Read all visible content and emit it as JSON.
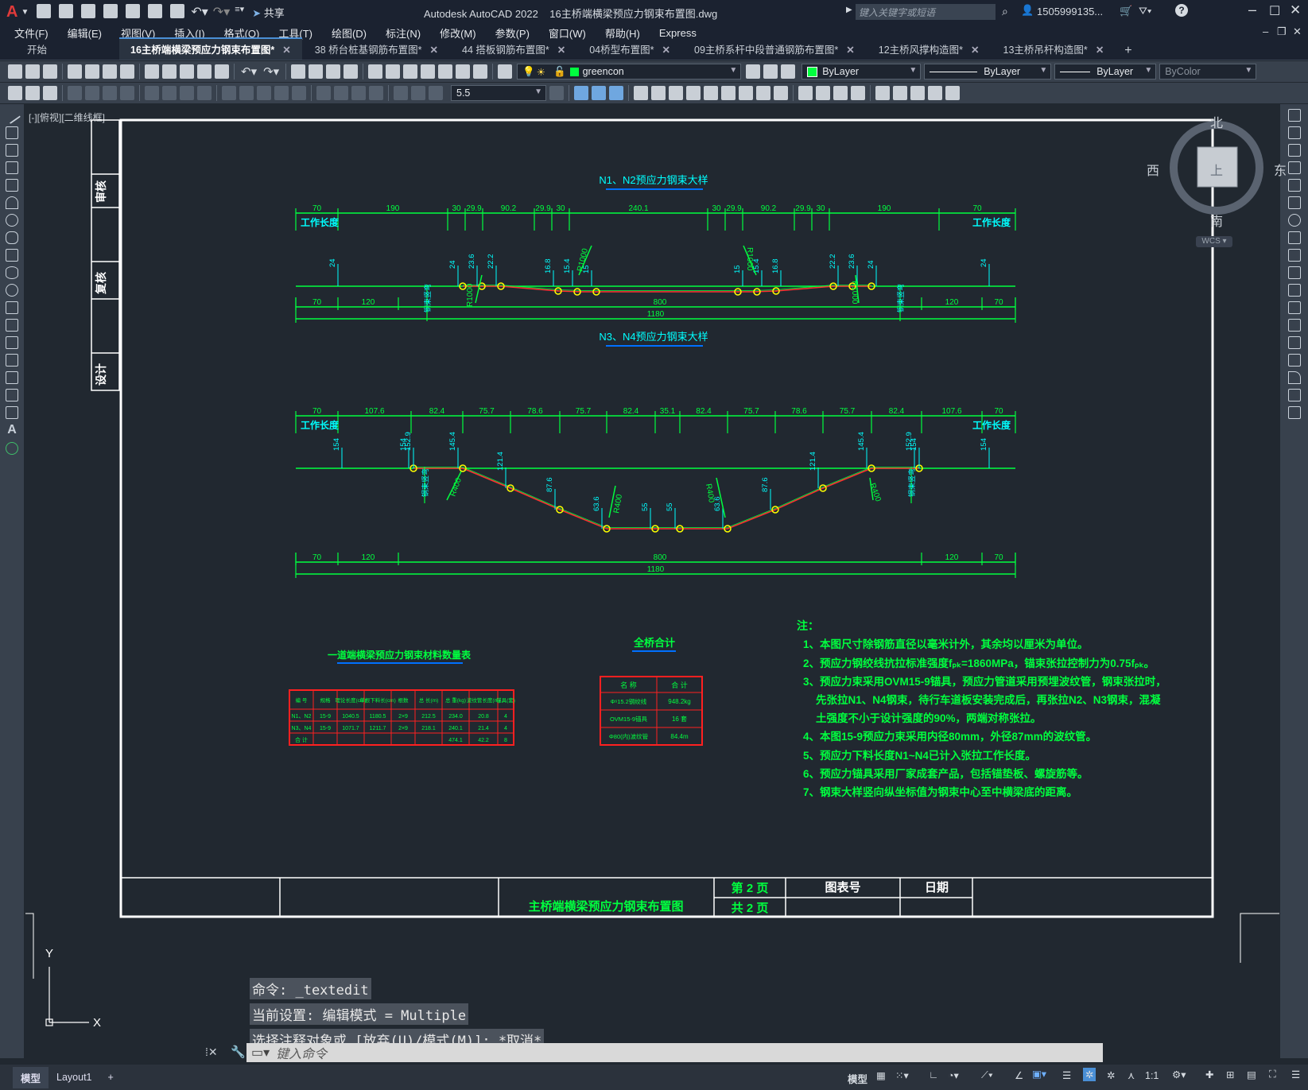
{
  "app": {
    "logo": "A",
    "share_label": "共享",
    "title": "Autodesk AutoCAD 2022",
    "document": "16主桥端横梁预应力钢束布置图.dwg",
    "search_placeholder": "键入关键字或短语",
    "user": "1505999135...",
    "help": "?"
  },
  "menu": [
    "文件(F)",
    "编辑(E)",
    "视图(V)",
    "插入(I)",
    "格式(O)",
    "工具(T)",
    "绘图(D)",
    "标注(N)",
    "修改(M)",
    "参数(P)",
    "窗口(W)",
    "帮助(H)",
    "Express"
  ],
  "tabs": [
    {
      "label": "开始",
      "closable": false
    },
    {
      "label": "16主桥端横梁预应力钢束布置图*",
      "closable": true,
      "active": true
    },
    {
      "label": "38 桥台桩基钢筋布置图*",
      "closable": true
    },
    {
      "label": "44 搭板钢筋布置图*",
      "closable": true
    },
    {
      "label": "04桥型布置图*",
      "closable": true
    },
    {
      "label": "09主桥系杆中段普通钢筋布置图*",
      "closable": true
    },
    {
      "label": "12主桥风撑构造图*",
      "closable": true
    },
    {
      "label": "13主桥吊杆构造图*",
      "closable": true
    }
  ],
  "new_tab": "+",
  "layers": {
    "current_layer": "greencon",
    "color": "ByLayer",
    "linetype": "ByLayer",
    "lineweight": "ByLayer",
    "plotstyle": "ByColor",
    "text_height": "5.5"
  },
  "viewport_label": "[-][俯视][二维线框]",
  "viewcube": {
    "north": "北",
    "south": "南",
    "east": "东",
    "west": "西",
    "top": "上",
    "wcs": "WCS"
  },
  "ucs": {
    "y": "Y",
    "x": "X"
  },
  "drawing": {
    "side_labels": [
      "审核",
      "复核",
      "设计"
    ],
    "n1n2_title": "N1、N2预应力钢束大样",
    "n3n4_title": "N3、N4预应力钢束大样",
    "work_length": "工作长度",
    "anchor_label": "钢束竖弯",
    "n1n2_top_dims": [
      "70",
      "190",
      "30",
      "29.9",
      "90.2",
      "29.9",
      "30",
      "240.1",
      "30",
      "29.9",
      "90.2",
      "29.9",
      "30",
      "190",
      "70"
    ],
    "n1n2_vert_dims": [
      "24",
      "24",
      "23.6",
      "22.2",
      "16.8",
      "15.4",
      "15",
      "15",
      "15.4",
      "16.8",
      "22.2",
      "23.6",
      "24",
      "24"
    ],
    "n1n2_radius": [
      "R1000",
      "R1000",
      "R1000",
      "R1000"
    ],
    "bottom_dims": [
      "70",
      "120",
      "800",
      "120",
      "70"
    ],
    "total": "1180",
    "n3n4_top_dims": [
      "70",
      "107.6",
      "82.4",
      "75.7",
      "78.6",
      "75.7",
      "82.4",
      "35.1",
      "82.4",
      "75.7",
      "78.6",
      "75.7",
      "82.4",
      "107.6",
      "70"
    ],
    "n3n4_vert_dims": [
      "154",
      "154",
      "152.9",
      "145.4",
      "121.4",
      "87.6",
      "63.6",
      "55",
      "55",
      "63.6",
      "87.6",
      "121.4",
      "145.4",
      "152.9",
      "154",
      "154"
    ],
    "n3n4_radius": [
      "R400",
      "R400",
      "R400",
      "R400"
    ],
    "table1_title": "一道端横梁预应力钢束材料数量表",
    "table1_headers": [
      "编 号",
      "规格",
      "理论长度(cm)",
      "单根下料长(cm)",
      "根数",
      "总 长(m)",
      "总 重(kg)",
      "波纹管长度(m)",
      "锚具(套)"
    ],
    "table1_rows": [
      [
        "N1、N2",
        "15-9",
        "1040.5",
        "1180.5",
        "2×9",
        "212.5",
        "234.0",
        "20.8",
        "4"
      ],
      [
        "N3、N4",
        "15-9",
        "1071.7",
        "1211.7",
        "2×9",
        "218.1",
        "240.1",
        "21.4",
        "4"
      ],
      [
        "合 计",
        "",
        "",
        "",
        "",
        "",
        "474.1",
        "42.2",
        "8"
      ]
    ],
    "table2_title": "全桥合计",
    "table2_headers": [
      "名 称",
      "合 计"
    ],
    "table2_rows": [
      [
        "Φˢ15.2钢绞线",
        "948.2kg"
      ],
      [
        "OVM15-9锚具",
        "16 套"
      ],
      [
        "Φ80(内)波纹管",
        "84.4m"
      ]
    ],
    "notes_title": "注：",
    "notes": [
      "1、本图尺寸除钢筋直径以毫米计外，其余均以厘米为单位。",
      "2、预应力钢绞线抗拉标准强度fₚₖ=1860MPa，锚束张拉控制力为0.75fₚₖ。",
      "3、预应力束采用OVM15-9锚具，预应力管道采用预埋波纹管，钢束张拉时，",
      "先张拉N1、N4钢束，待行车道板安装完成后，再张拉N2、N3钢束，混凝",
      "土强度不小于设计强度的90%，两端对称张拉。",
      "4、本图15-9预应力束采用内径80mm，外径87mm的波纹管。",
      "5、预应力下料长度N1~N4已计入张拉工作长度。",
      "6、预应力锚具采用厂家成套产品，包括锚垫板、螺旋筋等。",
      "7、钢束大样竖向纵坐标值为钢束中心至中横梁底的距离。"
    ],
    "tb_drawing_title": "主桥端横梁预应力钢束布置图",
    "tb_page": "第 2 页",
    "tb_total": "共 2 页",
    "tb_figno": "图表号",
    "tb_date": "日期"
  },
  "command": {
    "history": [
      "命令: _textedit",
      "当前设置: 编辑模式 = Multiple",
      "选择注释对象或 [放弃(U)/模式(M)]: *取消*"
    ],
    "placeholder": "键入命令"
  },
  "status": {
    "tabs": [
      "模型",
      "Layout1"
    ],
    "add": "+",
    "model_btn": "模型",
    "scale": "1:1"
  },
  "colors": {
    "drawing_green": "#00ff3f",
    "dim_cyan": "#00ffff",
    "table_red": "#ff2020",
    "tendon_red": "#ff3030",
    "node_yellow": "#ffff00"
  }
}
